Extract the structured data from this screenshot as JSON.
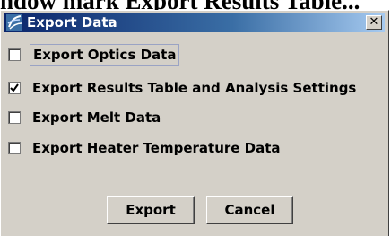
{
  "background_text": "ndow mark Export Results Table...",
  "window": {
    "title": "Export Data",
    "close_glyph": "✕"
  },
  "options": [
    {
      "label": "Export Optics Data",
      "checked": false
    },
    {
      "label": "Export Results Table and Analysis Settings",
      "checked": true
    },
    {
      "label": "Export Melt Data",
      "checked": false
    },
    {
      "label": "Export Heater Temperature Data",
      "checked": false
    }
  ],
  "buttons": {
    "export": "Export",
    "cancel": "Cancel"
  },
  "colors": {
    "dialog_bg": "#d4d0c8",
    "title_gradient_start": "#0a246a",
    "title_gradient_end": "#a6caf0"
  },
  "icons": {
    "title": "java-coffee-icon",
    "close": "close-icon",
    "check": "checkmark-icon"
  }
}
